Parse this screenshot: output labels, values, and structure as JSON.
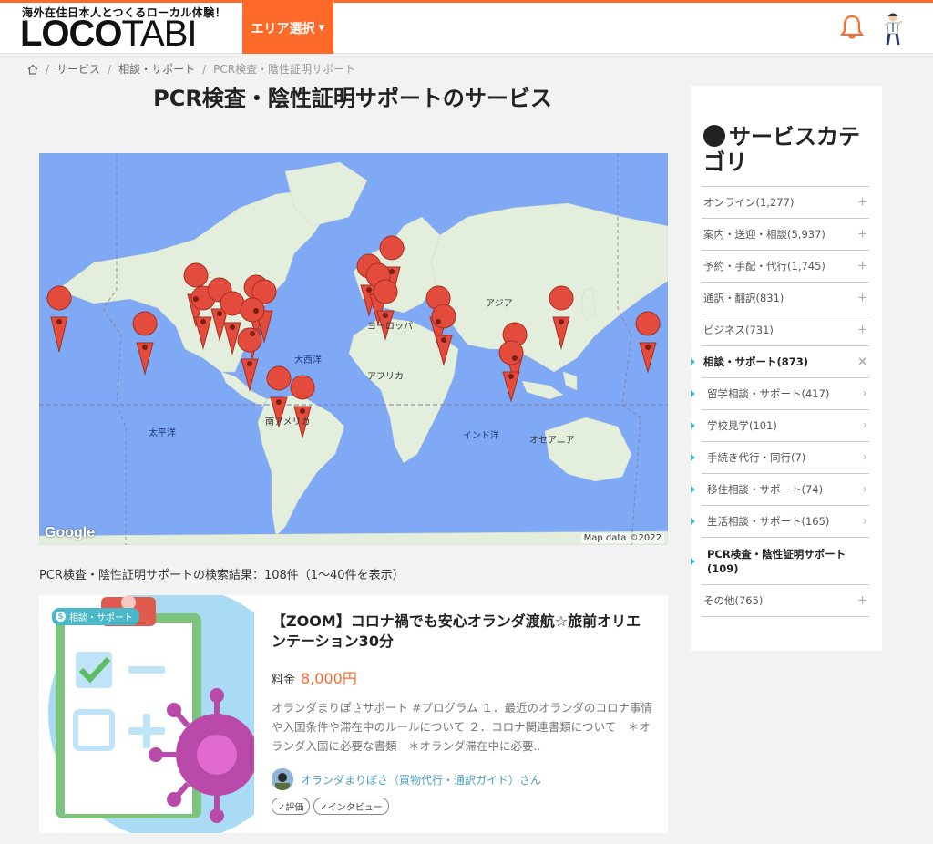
{
  "header": {
    "tagline": "海外在住日本人とつくるローカル体験！",
    "logo_bold": "LOCO",
    "logo_light": "TABI",
    "area_select": "エリア選択",
    "icons": [
      "bell-icon",
      "user-avatar"
    ],
    "accent_color": "#ff6a2b"
  },
  "breadcrumb": {
    "home_icon": "home-icon",
    "items": [
      "サービス",
      "相談・サポート"
    ],
    "current": "PCR検査・陰性証明サポート"
  },
  "page_title": "PCR検査・陰性証明サポートのサービス",
  "map": {
    "labels": [
      "アジア",
      "ヨーロッパ",
      "大西洋",
      "アフリカ",
      "太平洋",
      "インド洋",
      "オセアニア",
      "南アメリカ"
    ],
    "credit": "Map data ©2022",
    "brand": "Google"
  },
  "results_text": "PCR検査・陰性証明サポートの検索結果：108件（1〜40件を表示）",
  "card": {
    "category": "相談・サポート",
    "title": "【ZOOM】コロナ禍でも安心オランダ渡航☆旅前オリエンテーション30分",
    "price_label": "料金",
    "price_value": "8,000円",
    "description": "オランダまりぽさサポート #プログラム １．最近のオランダのコロナ事情や入国条件や滞在中のルールについて ２．コロナ関連書類について　＊オランダ入国に必要な書類　＊オランダ滞在中に必要..",
    "author": "オランダまりぽさ（買物代行・通訳ガイド）さん",
    "tags": [
      "評価",
      "インタビュー"
    ]
  },
  "sidebar": {
    "title": "サービスカテゴリ",
    "items": [
      {
        "label": "オンライン(1,277)",
        "mark": "+"
      },
      {
        "label": "案内・送迎・相談(5,937)",
        "mark": "+"
      },
      {
        "label": "予約・手配・代行(1,745)",
        "mark": "+"
      },
      {
        "label": "通訳・翻訳(831)",
        "mark": "+"
      },
      {
        "label": "ビジネス(731)",
        "mark": "+"
      },
      {
        "label": "相談・サポート(873)",
        "mark": "×"
      },
      {
        "label": "留学相談・サポート(417)",
        "mark": "›"
      },
      {
        "label": "学校見学(101)",
        "mark": "›"
      },
      {
        "label": "手続き代行・同行(7)",
        "mark": "›"
      },
      {
        "label": "移住相談・サポート(74)",
        "mark": "›"
      },
      {
        "label": "生活相談・サポート(165)",
        "mark": "›"
      },
      {
        "label": "PCR検査・陰性証明サポート(109)",
        "mark": ""
      },
      {
        "label": "その他(765)",
        "mark": "+"
      }
    ]
  }
}
